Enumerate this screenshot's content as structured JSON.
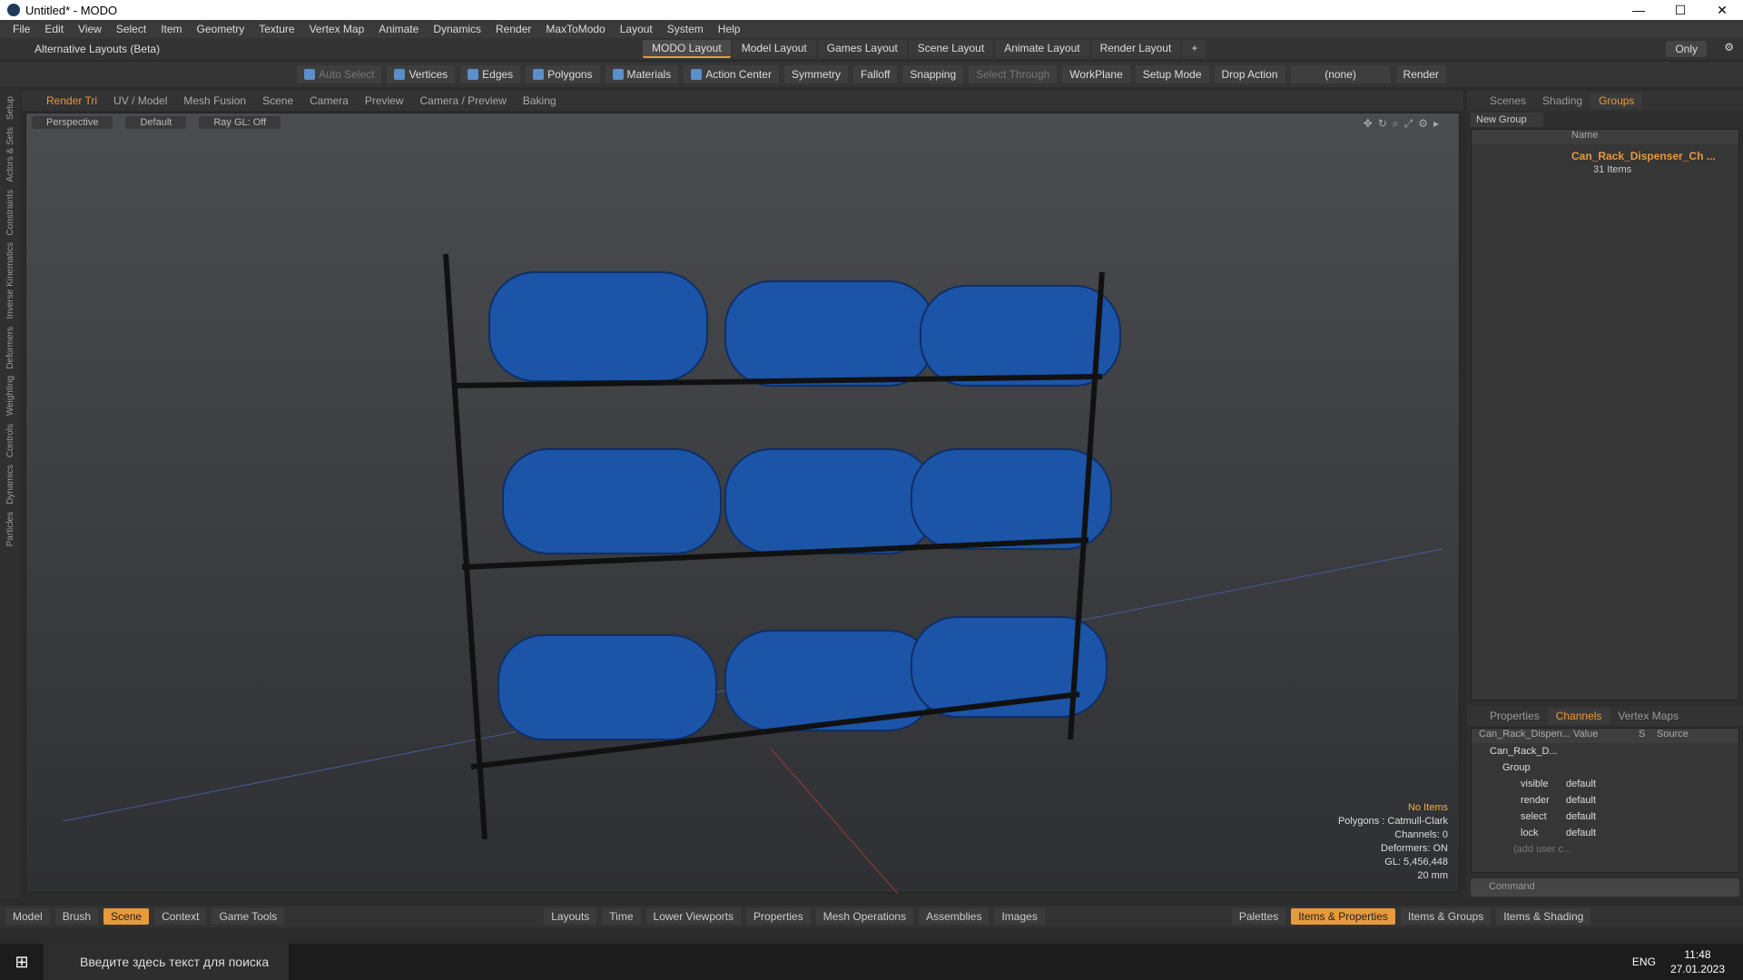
{
  "window": {
    "title": "Untitled* - MODO"
  },
  "menu": [
    "File",
    "Edit",
    "View",
    "Select",
    "Item",
    "Geometry",
    "Texture",
    "Vertex Map",
    "Animate",
    "Dynamics",
    "Render",
    "MaxToModo",
    "Layout",
    "System",
    "Help"
  ],
  "layouts": {
    "alt_label": "Alternative Layouts (Beta)",
    "tabs": [
      "MODO Layout",
      "Model Layout",
      "Games Layout",
      "Scene Layout",
      "Animate Layout",
      "Render Layout"
    ],
    "only": "Only"
  },
  "toolbar": [
    "Auto Select",
    "Vertices",
    "Edges",
    "Polygons",
    "Materials",
    "Action Center",
    "Symmetry",
    "Falloff",
    "Snapping",
    "Select Through",
    "WorkPlane",
    "Setup Mode",
    "Drop Action",
    "(none)",
    "Render"
  ],
  "left_strip": [
    "Setup",
    "Actors & Sets",
    "Constraints",
    "Inverse Kinematics",
    "Deformers",
    "Weighting",
    "Controls",
    "Dynamics",
    "Particles"
  ],
  "viewport_tabs": [
    "Render Tri",
    "UV / Model",
    "Mesh Fusion",
    "Scene",
    "Camera",
    "Preview",
    "Camera / Preview",
    "Baking"
  ],
  "viewport_bar": [
    "Perspective",
    "Default",
    "Ray GL: Off"
  ],
  "stats": {
    "items": "No Items",
    "polygons": "Polygons : Catmull-Clark",
    "channels": "Channels: 0",
    "deformers": "Deformers: ON",
    "gl": "GL: 5,456,448",
    "size": "20 mm"
  },
  "right_tabs": [
    "Scenes",
    "Shading",
    "Groups"
  ],
  "groups": {
    "new": "New Group",
    "name_col": "Name",
    "item": "Can_Rack_Dispenser_Ch ...",
    "count": "31 Items"
  },
  "channel_tabs": [
    "Properties",
    "Channels",
    "Vertex Maps"
  ],
  "channels": {
    "col_name": "Can_Rack_Dispen...",
    "col_value": "Value",
    "col_s": "S",
    "col_source": "Source",
    "root": "Can_Rack_D...",
    "group": "Group",
    "rows": [
      {
        "name": "visible",
        "value": "default"
      },
      {
        "name": "render",
        "value": "default"
      },
      {
        "name": "select",
        "value": "default"
      },
      {
        "name": "lock",
        "value": "default"
      }
    ],
    "add": "(add user c..."
  },
  "command": "Command",
  "bottom": [
    "Model",
    "Brush",
    "Scene",
    "Context",
    "Game Tools",
    "Layouts",
    "Time",
    "Lower Viewports",
    "Properties",
    "Mesh Operations",
    "Assemblies",
    "Images",
    "Palettes",
    "Items & Properties",
    "Items & Groups",
    "Items & Shading"
  ],
  "taskbar": {
    "search": "Введите здесь текст для поиска",
    "lang": "ENG",
    "time": "11:48",
    "date": "27.01.2023"
  }
}
